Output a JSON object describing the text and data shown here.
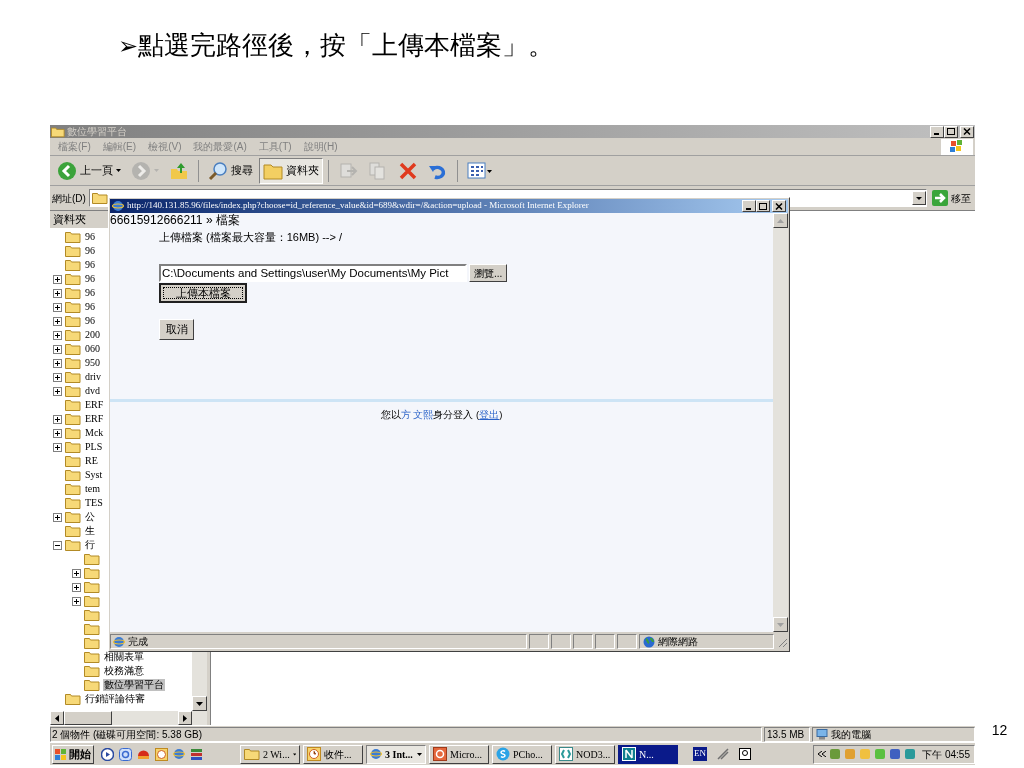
{
  "slide": {
    "bullet": "➢",
    "heading": "點選完路徑後，按「上傳本檔案」。",
    "page_number": "12"
  },
  "explorer": {
    "title": "數位學習平台",
    "menu": [
      "檔案(F)",
      "編輯(E)",
      "檢視(V)",
      "我的最愛(A)",
      "工具(T)",
      "說明(H)"
    ],
    "toolbar": [
      {
        "kind": "back",
        "label": "上一頁",
        "selected": false,
        "disabled": false
      },
      {
        "kind": "forward",
        "selected": false,
        "disabled": true
      },
      {
        "kind": "up",
        "selected": false,
        "disabled": false
      },
      {
        "kind": "search",
        "label": "搜尋",
        "selected": false,
        "disabled": false
      },
      {
        "kind": "folders",
        "label": "資料夾",
        "selected": true,
        "disabled": false
      },
      {
        "kind": "move",
        "selected": false,
        "disabled": true
      },
      {
        "kind": "copy",
        "selected": false,
        "disabled": true
      },
      {
        "kind": "delete",
        "selected": false,
        "disabled": false
      },
      {
        "kind": "undo",
        "selected": false,
        "disabled": false
      },
      {
        "kind": "views",
        "selected": false,
        "disabled": false
      }
    ],
    "address_label": "網址(D)",
    "go_label": "移至",
    "folder_pane_title": "資料夾",
    "tree": [
      {
        "label": "96",
        "expandable": false,
        "selected": false
      },
      {
        "label": "96",
        "expandable": false,
        "selected": false
      },
      {
        "label": "96",
        "expandable": false,
        "selected": false
      },
      {
        "label": "96",
        "expandable": true,
        "expanded": false,
        "selected": false
      },
      {
        "label": "96",
        "expandable": true,
        "expanded": false,
        "selected": false
      },
      {
        "label": "96",
        "expandable": true,
        "expanded": false,
        "selected": false
      },
      {
        "label": "96",
        "expandable": true,
        "expanded": false,
        "selected": false
      },
      {
        "label": "200",
        "expandable": true,
        "expanded": false,
        "selected": false
      },
      {
        "label": "060",
        "expandable": true,
        "expanded": false,
        "selected": false
      },
      {
        "label": "950",
        "expandable": true,
        "expanded": false,
        "selected": false
      },
      {
        "label": "driv",
        "expandable": true,
        "expanded": false,
        "selected": false
      },
      {
        "label": "dvd",
        "expandable": true,
        "expanded": false,
        "selected": false
      },
      {
        "label": "ERF",
        "expandable": false,
        "selected": false
      },
      {
        "label": "ERF",
        "expandable": true,
        "expanded": false,
        "selected": false
      },
      {
        "label": "Mck",
        "expandable": true,
        "expanded": false,
        "selected": false
      },
      {
        "label": "PLS",
        "expandable": true,
        "expanded": false,
        "selected": false
      },
      {
        "label": "RE",
        "expandable": false,
        "selected": false
      },
      {
        "label": "Syst",
        "expandable": false,
        "selected": false
      },
      {
        "label": "tem",
        "expandable": false,
        "selected": false
      },
      {
        "label": "TES",
        "expandable": false,
        "selected": false
      },
      {
        "label": "公",
        "expandable": true,
        "expanded": false,
        "selected": false
      },
      {
        "label": "生",
        "expandable": false,
        "selected": false
      },
      {
        "label": "行",
        "expandable": true,
        "expanded": true,
        "selected": false,
        "children": [
          {
            "expandable": false,
            "selected": false
          },
          {
            "expandable": true,
            "expanded": false,
            "selected": false
          },
          {
            "expandable": true,
            "expanded": false,
            "selected": false
          },
          {
            "expandable": true,
            "expanded": false,
            "selected": false
          },
          {
            "expandable": false,
            "selected": false
          },
          {
            "expandable": false,
            "selected": false
          },
          {
            "expandable": false,
            "selected": false
          },
          {
            "label": "相關表單",
            "expandable": false,
            "selected": false
          },
          {
            "label": "校務滿意",
            "expandable": false,
            "selected": false
          },
          {
            "label": "數位學習平台",
            "expandable": false,
            "selected": true
          }
        ]
      },
      {
        "label": "行銷評論待審",
        "expandable": false,
        "selected": false
      }
    ],
    "status": {
      "objects": "2 個物件 (磁碟可用空間: 5.38 GB)",
      "size": "13.5 MB",
      "zone": "我的電腦"
    }
  },
  "popup": {
    "title": "http://140.131.85.96/files/index.php?choose=id_reference_value&id=689&wdir=/&action=upload - Microsoft Internet Explorer",
    "breadcrumb": "66615912666211 » 檔案",
    "upload_label": "上傳檔案 (檔案最大容量：16MB) --> /",
    "file_path": "C:\\Documents and Settings\\user\\My Documents\\My Pict",
    "browse_button": "瀏覽...",
    "upload_button": "上傳本檔案",
    "cancel_button": "取消",
    "login": {
      "prefix": "您以",
      "user": "方 文熙",
      "middle": "身分登入 (",
      "logout": "登出",
      "suffix": ")"
    },
    "status": "完成",
    "zone": "網際網路"
  },
  "taskbar": {
    "start": "開始",
    "tasks": [
      {
        "label": "2 Wi...",
        "kind": "folder",
        "has_menu": true,
        "selected": false,
        "flashing": false
      },
      {
        "label": "收件...",
        "kind": "mail",
        "has_menu": false,
        "selected": false,
        "flashing": false
      },
      {
        "label": "3 Int...",
        "kind": "browser",
        "has_menu": true,
        "selected": true,
        "flashing": false
      },
      {
        "label": "Micro...",
        "kind": "slides",
        "has_menu": false,
        "selected": false,
        "flashing": false
      },
      {
        "label": "PCho...",
        "kind": "chat",
        "has_menu": false,
        "selected": false,
        "flashing": false
      },
      {
        "label": "NOD3...",
        "kind": "shield",
        "has_menu": false,
        "selected": false,
        "flashing": false
      },
      {
        "label": "N...",
        "kind": "app",
        "has_menu": false,
        "selected": false,
        "flashing": true
      }
    ],
    "language": "EN",
    "clock": "下午 04:55"
  }
}
